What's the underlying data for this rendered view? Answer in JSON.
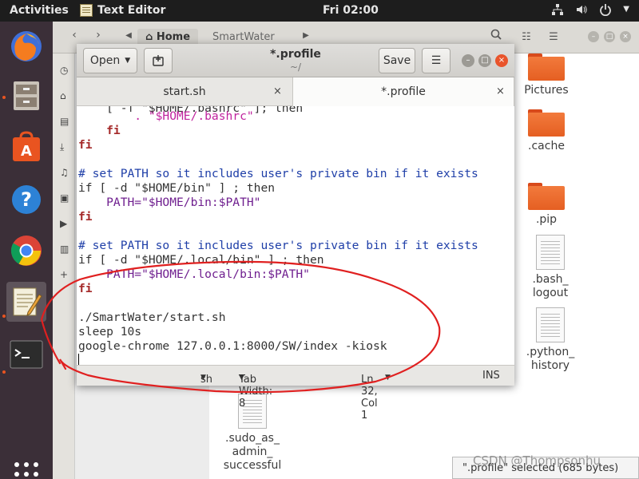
{
  "topbar": {
    "activities": "Activities",
    "app_menu": "Text Editor",
    "clock": "Fri 02:00",
    "tray_icons": [
      "network-icon",
      "volume-icon",
      "power-icon",
      "chevron-down-icon"
    ]
  },
  "dock": {
    "apps": [
      "firefox-icon",
      "files-icon",
      "software-center-icon",
      "help-icon",
      "chrome-icon",
      "text-editor-icon",
      "terminal-icon"
    ],
    "show_apps": "grid-icon"
  },
  "file_manager": {
    "breadcrumbs": [
      "Home",
      "SmartWater"
    ],
    "items": [
      {
        "label": "Pictures",
        "icon": "folder"
      },
      {
        "label": ".cache",
        "icon": "folder"
      },
      {
        "label": ".pip",
        "icon": "folder"
      },
      {
        "label_lines": [
          ".bash_",
          "logout"
        ],
        "icon": "document"
      },
      {
        "label_lines": [
          ".python_",
          "history"
        ],
        "icon": "document"
      },
      {
        "label_lines": [
          ".sudo_as_",
          "admin_",
          "successful"
        ],
        "icon": "document"
      }
    ],
    "status_text": "\".profile\" selected (685 bytes)"
  },
  "editor": {
    "open_label": "Open",
    "save_label": "Save",
    "title": "*.profile",
    "subtitle": "~/",
    "tabs": [
      {
        "label": "start.sh",
        "active": false
      },
      {
        "label": "*.profile",
        "active": true
      }
    ],
    "code_lines": [
      "    [ -f \"$HOME/.bashrc\" ]; then",
      "        . \"$HOME/.bashrc\"",
      "    fi",
      "fi",
      "",
      "# set PATH so it includes user's private bin if it exists",
      "if [ -d \"$HOME/bin\" ] ; then",
      "    PATH=\"$HOME/bin:$PATH\"",
      "fi",
      "",
      "# set PATH so it includes user's private bin if it exists",
      "if [ -d \"$HOME/.local/bin\" ] ; then",
      "    PATH=\"$HOME/.local/bin:$PATH\"",
      "fi",
      "",
      "./SmartWater/start.sh",
      "sleep 10s",
      "google-chrome 127.0.0.1:8000/SW/index -kiosk",
      ""
    ],
    "status": {
      "language": "sh",
      "tab_width": "Tab Width: 8",
      "position": "Ln 32, Col 1",
      "mode": "INS"
    }
  },
  "watermark": "CSDN @Thompsonhu",
  "colors": {
    "accent": "#e95420",
    "annotation": "#e02020"
  }
}
